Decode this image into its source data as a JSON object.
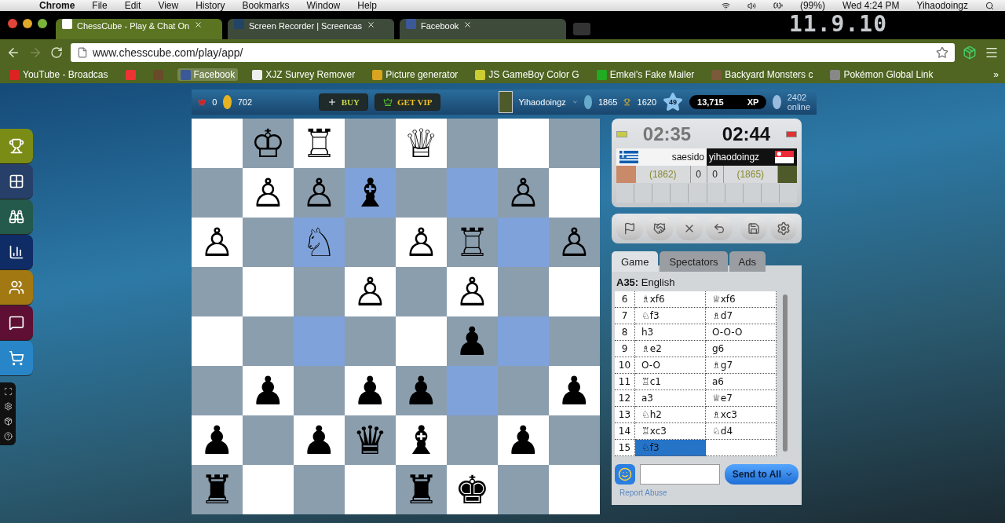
{
  "menu_bar": {
    "items": [
      "Chrome",
      "File",
      "Edit",
      "View",
      "History",
      "Bookmarks",
      "Window",
      "Help"
    ],
    "status": [
      "(99%)",
      "Wed 4:24 PM",
      "Yihaodoingz"
    ]
  },
  "browser_tabs": [
    {
      "title": "ChessCube - Play & Chat On",
      "selected": true
    },
    {
      "title": "Screen Recorder | Screencas",
      "selected": false
    },
    {
      "title": "Facebook",
      "selected": false
    }
  ],
  "clock_display": "11.9.10",
  "address": "www.chesscube.com/play/app/",
  "bookmarks": [
    {
      "kind": "link",
      "label": "YouTube - Broadcas",
      "selected": false
    },
    {
      "kind": "icon",
      "selected": false
    },
    {
      "kind": "icon",
      "selected": false
    },
    {
      "kind": "link",
      "label": "Facebook",
      "selected": true
    },
    {
      "kind": "link",
      "label": "XJZ Survey Remover",
      "selected": false
    },
    {
      "kind": "link",
      "label": "Picture generator",
      "selected": false
    },
    {
      "kind": "link",
      "label": "JS GameBoy Color G",
      "selected": false
    },
    {
      "kind": "link",
      "label": "Emkei's Fake Mailer",
      "selected": false
    },
    {
      "kind": "link",
      "label": "Backyard Monsters c",
      "selected": false
    },
    {
      "kind": "link",
      "label": "Pokémon Global Link",
      "selected": false
    }
  ],
  "bookmarks_more": "»",
  "sidebar": [
    {
      "color": "#7a8c16"
    },
    {
      "color": "#27406a"
    },
    {
      "color": "#245a4c"
    },
    {
      "color": "#0f2c66"
    },
    {
      "color": "#a27812"
    },
    {
      "color": "#5e0f33"
    },
    {
      "color": "#2886c8"
    }
  ],
  "top_bar": {
    "crowns": "0",
    "coins": "702",
    "buy": "BUY",
    "vip": "GET VIP",
    "username": "Yihaodoingz",
    "rating": "1865",
    "trophies": "1620",
    "level": "49",
    "xp": "13,715",
    "xp_label": "XP",
    "online_count": "2402",
    "online_label": "online"
  },
  "board": {
    "rows": [
      {
        "squares": [
          {
            "highlighted": false
          },
          {
            "piece": "♔",
            "highlighted": false
          },
          {
            "piece": "♖",
            "highlighted": false
          },
          {
            "highlighted": false
          },
          {
            "piece": "♕",
            "highlighted": false
          },
          {
            "highlighted": false
          },
          {
            "highlighted": false
          },
          {
            "highlighted": false
          }
        ]
      },
      {
        "squares": [
          {
            "highlighted": false
          },
          {
            "piece": "♙",
            "highlighted": false
          },
          {
            "piece": "♙",
            "highlighted": false
          },
          {
            "piece": "♝",
            "highlighted": true
          },
          {
            "highlighted": false
          },
          {
            "highlighted": true
          },
          {
            "piece": "♙",
            "highlighted": false
          },
          {
            "highlighted": false
          }
        ]
      },
      {
        "squares": [
          {
            "piece": "♙",
            "highlighted": false
          },
          {
            "highlighted": false
          },
          {
            "piece": "♘",
            "highlighted": true
          },
          {
            "highlighted": false
          },
          {
            "piece": "♙",
            "highlighted": false
          },
          {
            "piece": "♖",
            "highlighted": false
          },
          {
            "highlighted": true
          },
          {
            "piece": "♙",
            "highlighted": false
          }
        ]
      },
      {
        "squares": [
          {
            "highlighted": false
          },
          {
            "highlighted": false
          },
          {
            "highlighted": false
          },
          {
            "piece": "♙",
            "highlighted": false
          },
          {
            "highlighted": false
          },
          {
            "piece": "♙",
            "highlighted": false
          },
          {
            "highlighted": false
          },
          {
            "highlighted": false
          }
        ]
      },
      {
        "squares": [
          {
            "highlighted": false
          },
          {
            "highlighted": false
          },
          {
            "highlighted": true
          },
          {
            "highlighted": false
          },
          {
            "highlighted": false
          },
          {
            "piece": "♟",
            "highlighted": false
          },
          {
            "highlighted": true
          },
          {
            "highlighted": false
          }
        ]
      },
      {
        "squares": [
          {
            "highlighted": false
          },
          {
            "piece": "♟",
            "highlighted": false
          },
          {
            "highlighted": false
          },
          {
            "piece": "♟",
            "highlighted": false
          },
          {
            "piece": "♟",
            "highlighted": false
          },
          {
            "highlighted": true
          },
          {
            "highlighted": false
          },
          {
            "piece": "♟",
            "highlighted": false
          }
        ]
      },
      {
        "squares": [
          {
            "piece": "♟",
            "highlighted": false
          },
          {
            "highlighted": false
          },
          {
            "piece": "♟",
            "highlighted": false
          },
          {
            "piece": "♛",
            "highlighted": false
          },
          {
            "piece": "♝",
            "highlighted": false
          },
          {
            "highlighted": false
          },
          {
            "piece": "♟",
            "highlighted": false
          },
          {
            "highlighted": false
          }
        ]
      },
      {
        "squares": [
          {
            "piece": "♜",
            "highlighted": false
          },
          {
            "highlighted": false
          },
          {
            "highlighted": false
          },
          {
            "highlighted": false
          },
          {
            "piece": "♜",
            "highlighted": false
          },
          {
            "piece": "♚",
            "highlighted": false
          },
          {
            "highlighted": false
          },
          {
            "highlighted": false
          }
        ]
      }
    ]
  },
  "players": [
    {
      "name": "saesido",
      "rating": "(1862)",
      "score": "0",
      "clock": "02:35",
      "active": false
    },
    {
      "name": "yihaodoingz",
      "rating": "(1865)",
      "score": "0",
      "clock": "02:44",
      "active": true
    }
  ],
  "panel_tabs": [
    {
      "label": "Game",
      "selected": true
    },
    {
      "label": "Spectators",
      "selected": false
    },
    {
      "label": "Ads",
      "selected": false
    }
  ],
  "opening": {
    "code": "A35:",
    "name": "English"
  },
  "moves": [
    {
      "number": "6",
      "white": {
        "text": "♗xf6",
        "selected": false
      },
      "black": {
        "text": "♕xf6",
        "selected": false
      }
    },
    {
      "number": "7",
      "white": {
        "text": "♘f3",
        "selected": false
      },
      "black": {
        "text": "♗d7",
        "selected": false
      }
    },
    {
      "number": "8",
      "white": {
        "text": "h3",
        "selected": false
      },
      "black": {
        "text": "O-O-O",
        "selected": false
      }
    },
    {
      "number": "9",
      "white": {
        "text": "♗e2",
        "selected": false
      },
      "black": {
        "text": "g6",
        "selected": false
      }
    },
    {
      "number": "10",
      "white": {
        "text": "O-O",
        "selected": false
      },
      "black": {
        "text": "♗g7",
        "selected": false
      }
    },
    {
      "number": "11",
      "white": {
        "text": "♖c1",
        "selected": false
      },
      "black": {
        "text": "a6",
        "selected": false
      }
    },
    {
      "number": "12",
      "white": {
        "text": "a3",
        "selected": false
      },
      "black": {
        "text": "♕e7",
        "selected": false
      }
    },
    {
      "number": "13",
      "white": {
        "text": "♘h2",
        "selected": false
      },
      "black": {
        "text": "♗xc3",
        "selected": false
      }
    },
    {
      "number": "14",
      "white": {
        "text": "♖xc3",
        "selected": false
      },
      "black": {
        "text": "♘d4",
        "selected": false
      }
    },
    {
      "number": "15",
      "white": {
        "text": "♘f3",
        "selected": true
      },
      "black": {
        "selected": false
      }
    }
  ],
  "chat": {
    "send": "Send to All",
    "report": "Report Abuse"
  }
}
